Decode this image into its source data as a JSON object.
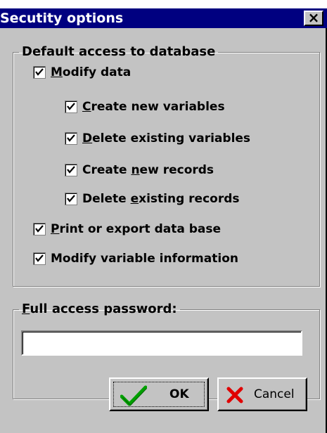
{
  "window": {
    "title": "Secutity options",
    "close_glyph": "×"
  },
  "default_access": {
    "legend": "Default access to database",
    "modify_data": {
      "mnemonic": "M",
      "rest": "odify data",
      "checked": true
    },
    "sub_options": [
      {
        "pre": "",
        "mnemonic": "C",
        "post": "reate new variables",
        "checked": true
      },
      {
        "pre": "",
        "mnemonic": "D",
        "post": "elete existing variables",
        "checked": true
      },
      {
        "pre": "Create ",
        "mnemonic": "n",
        "post": "ew records",
        "checked": true
      },
      {
        "pre": "Delete ",
        "mnemonic": "e",
        "post": "xisting records",
        "checked": true
      }
    ],
    "print_export": {
      "mnemonic": "P",
      "rest": "rint or export data base",
      "checked": true
    },
    "modify_variable_info": {
      "label": "Modify variable information",
      "checked": true
    }
  },
  "password": {
    "legend_mnemonic": "F",
    "legend_rest": "ull access password:",
    "value": ""
  },
  "buttons": {
    "ok": {
      "label": "OK",
      "icon": "green-checkmark-icon",
      "color": "#00a000"
    },
    "cancel": {
      "label": "Cancel",
      "icon": "red-x-icon",
      "color": "#e00000"
    }
  },
  "colors": {
    "titlebar": "#000080",
    "face": "#c3c3c3"
  }
}
